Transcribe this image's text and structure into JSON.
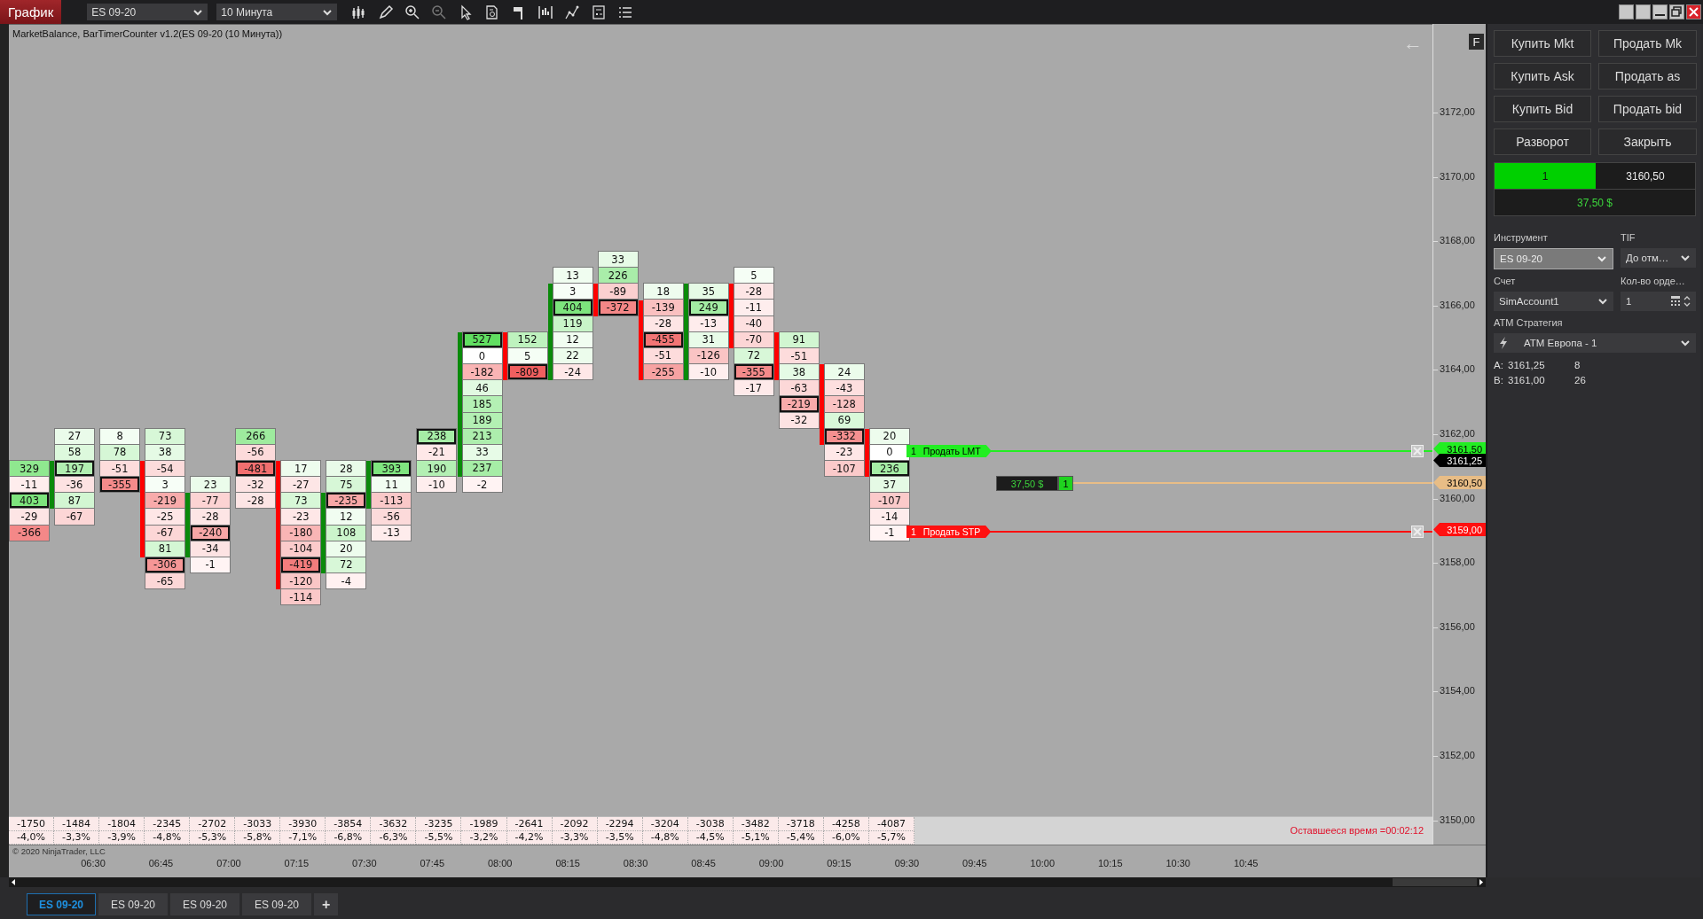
{
  "toolbar": {
    "app_button": "График",
    "instrument": "ES 09-20",
    "interval": "10 Минута"
  },
  "chart": {
    "title": "MarketBalance, BarTimerCounter v1.2(ES 09-20 (10 Минута))",
    "back_arrow": "←",
    "flag": "F",
    "bars": [
      {
        "cells": [
          {
            "value": "329",
            "highlight": false
          },
          {
            "value": "-11",
            "highlight": false
          },
          {
            "value": "403",
            "highlight": true
          },
          {
            "value": "-29",
            "highlight": false
          },
          {
            "value": "-366",
            "highlight": false
          }
        ]
      },
      {
        "color": "#0a8a0a",
        "cells": [
          {
            "value": "27",
            "highlight": false
          },
          {
            "value": "58",
            "highlight": false
          },
          {
            "value": "197",
            "highlight": true
          },
          {
            "value": "-36",
            "highlight": false
          },
          {
            "value": "87",
            "highlight": false
          },
          {
            "value": "-67",
            "highlight": false
          }
        ]
      },
      {
        "cells": [
          {
            "value": "8",
            "highlight": false
          },
          {
            "value": "78",
            "highlight": false
          },
          {
            "value": "-51",
            "highlight": false
          },
          {
            "value": "-355",
            "highlight": true
          }
        ]
      },
      {
        "color": "#ff0000",
        "cells": [
          {
            "value": "73",
            "highlight": false
          },
          {
            "value": "38",
            "highlight": false
          },
          {
            "value": "-54",
            "highlight": false
          },
          {
            "value": "3",
            "highlight": false
          },
          {
            "value": "-219",
            "highlight": false
          },
          {
            "value": "-25",
            "highlight": false
          },
          {
            "value": "-67",
            "highlight": false
          },
          {
            "value": "81",
            "highlight": false
          },
          {
            "value": "-306",
            "highlight": true
          },
          {
            "value": "-65",
            "highlight": false
          }
        ]
      },
      {
        "color": "#0a8a0a",
        "cells": [
          {
            "value": "23",
            "highlight": false
          },
          {
            "value": "-77",
            "highlight": false
          },
          {
            "value": "-28",
            "highlight": false
          },
          {
            "value": "-240",
            "highlight": true
          },
          {
            "value": "-34",
            "highlight": false
          },
          {
            "value": "-1",
            "highlight": false
          }
        ]
      },
      {
        "cells": [
          {
            "value": "266",
            "highlight": false
          },
          {
            "value": "-56",
            "highlight": false
          },
          {
            "value": "-481",
            "highlight": true
          },
          {
            "value": "-32",
            "highlight": false
          },
          {
            "value": "-28",
            "highlight": false
          }
        ]
      },
      {
        "color": "#ff0000",
        "cells": [
          {
            "value": "17",
            "highlight": false
          },
          {
            "value": "-27",
            "highlight": false
          },
          {
            "value": "73",
            "highlight": false
          },
          {
            "value": "-23",
            "highlight": false
          },
          {
            "value": "-180",
            "highlight": false
          },
          {
            "value": "-104",
            "highlight": false
          },
          {
            "value": "-419",
            "highlight": true
          },
          {
            "value": "-120",
            "highlight": false
          },
          {
            "value": "-114",
            "highlight": false
          }
        ]
      },
      {
        "color": "#0a8a0a",
        "cells": [
          {
            "value": "28",
            "highlight": false
          },
          {
            "value": "75",
            "highlight": false
          },
          {
            "value": "-235",
            "highlight": true
          },
          {
            "value": "12",
            "highlight": false
          },
          {
            "value": "108",
            "highlight": false
          },
          {
            "value": "20",
            "highlight": false
          },
          {
            "value": "72",
            "highlight": false
          },
          {
            "value": "-4",
            "highlight": false
          }
        ]
      },
      {
        "color": "#0a8a0a",
        "cells": [
          {
            "value": "393",
            "highlight": true
          },
          {
            "value": "11",
            "highlight": false
          },
          {
            "value": "-113",
            "highlight": false
          },
          {
            "value": "-56",
            "highlight": false
          },
          {
            "value": "-13",
            "highlight": false
          }
        ]
      },
      {
        "cells": [
          {
            "value": "238",
            "highlight": true
          },
          {
            "value": "-21",
            "highlight": false
          },
          {
            "value": "190",
            "highlight": false
          },
          {
            "value": "-10",
            "highlight": false
          }
        ]
      },
      {
        "color": "#0a8a0a",
        "cells": [
          {
            "value": "527",
            "highlight": true
          },
          {
            "value": "0",
            "highlight": false
          },
          {
            "value": "-182",
            "highlight": false
          },
          {
            "value": "46",
            "highlight": false
          },
          {
            "value": "185",
            "highlight": false
          },
          {
            "value": "189",
            "highlight": false
          },
          {
            "value": "213",
            "highlight": false
          },
          {
            "value": "33",
            "highlight": false
          },
          {
            "value": "237",
            "highlight": false
          },
          {
            "value": "-2",
            "highlight": false
          }
        ]
      },
      {
        "color": "#ff0000",
        "cells": [
          {
            "value": "152",
            "highlight": false
          },
          {
            "value": "5",
            "highlight": false
          },
          {
            "value": "-809",
            "highlight": true
          }
        ]
      },
      {
        "color": "#0a8a0a",
        "cells": [
          {
            "value": "13",
            "highlight": false
          },
          {
            "value": "3",
            "highlight": false
          },
          {
            "value": "404",
            "highlight": true
          },
          {
            "value": "119",
            "highlight": false
          },
          {
            "value": "12",
            "highlight": false
          },
          {
            "value": "22",
            "highlight": false
          },
          {
            "value": "-24",
            "highlight": false
          }
        ]
      },
      {
        "color": "#ff0000",
        "cells": [
          {
            "value": "33",
            "highlight": false
          },
          {
            "value": "226",
            "highlight": false
          },
          {
            "value": "-89",
            "highlight": false
          },
          {
            "value": "-372",
            "highlight": true
          }
        ]
      },
      {
        "color": "#ff0000",
        "cells": [
          {
            "value": "18",
            "highlight": false
          },
          {
            "value": "-139",
            "highlight": false
          },
          {
            "value": "-28",
            "highlight": false
          },
          {
            "value": "-455",
            "highlight": true
          },
          {
            "value": "-51",
            "highlight": false
          },
          {
            "value": "-255",
            "highlight": false
          }
        ]
      },
      {
        "color": "#0a8a0a",
        "cells": [
          {
            "value": "35",
            "highlight": false
          },
          {
            "value": "249",
            "highlight": true
          },
          {
            "value": "-13",
            "highlight": false
          },
          {
            "value": "31",
            "highlight": false
          },
          {
            "value": "-126",
            "highlight": false
          },
          {
            "value": "-10",
            "highlight": false
          }
        ]
      },
      {
        "color": "#ff0000",
        "cells": [
          {
            "value": "5",
            "highlight": false
          },
          {
            "value": "-28",
            "highlight": false
          },
          {
            "value": "-11",
            "highlight": false
          },
          {
            "value": "-40",
            "highlight": false
          },
          {
            "value": "-70",
            "highlight": false
          },
          {
            "value": "72",
            "highlight": false
          },
          {
            "value": "-355",
            "highlight": true
          },
          {
            "value": "-17",
            "highlight": false
          }
        ]
      },
      {
        "color": "#ff0000",
        "cells": [
          {
            "value": "91",
            "highlight": false
          },
          {
            "value": "-51",
            "highlight": false
          },
          {
            "value": "38",
            "highlight": false
          },
          {
            "value": "-63",
            "highlight": false
          },
          {
            "value": "-219",
            "highlight": true
          },
          {
            "value": "-32",
            "highlight": false
          }
        ]
      },
      {
        "color": "#ff0000",
        "cells": [
          {
            "value": "24",
            "highlight": false
          },
          {
            "value": "-43",
            "highlight": false
          },
          {
            "value": "-128",
            "highlight": false
          },
          {
            "value": "69",
            "highlight": false
          },
          {
            "value": "-332",
            "highlight": true
          },
          {
            "value": "-23",
            "highlight": false
          },
          {
            "value": "-107",
            "highlight": false
          }
        ]
      },
      {
        "color": "#ff0000",
        "cells": [
          {
            "value": "20",
            "highlight": false
          },
          {
            "value": "0",
            "highlight": false
          },
          {
            "value": "236",
            "highlight": true
          },
          {
            "value": "37",
            "highlight": false
          },
          {
            "value": "-107",
            "highlight": false
          },
          {
            "value": "-14",
            "highlight": false
          },
          {
            "value": "-1",
            "highlight": false
          }
        ]
      }
    ],
    "orders": [
      {
        "kind": "limit",
        "quantity": "1",
        "label": "Продать LMT",
        "price": "3161,50"
      },
      {
        "kind": "stop",
        "quantity": "1",
        "label": "Продать STP",
        "price": "3159,00"
      }
    ],
    "position": {
      "pnl": "37,50 $",
      "quantity": "1",
      "price": "3160,50"
    },
    "last_price": "3161,25",
    "price_labels": [
      "3172,00",
      "3170,00",
      "3168,00",
      "3166,00",
      "3164,00",
      "3162,00",
      "3160,00",
      "3158,00",
      "3156,00",
      "3154,00",
      "3152,00",
      "3150,00"
    ],
    "summary": [
      {
        "delta": "-1750",
        "percent": "-4,0%"
      },
      {
        "delta": "-1484",
        "percent": "-3,3%"
      },
      {
        "delta": "-1804",
        "percent": "-3,9%"
      },
      {
        "delta": "-2345",
        "percent": "-4,8%"
      },
      {
        "delta": "-2702",
        "percent": "-5,3%"
      },
      {
        "delta": "-3033",
        "percent": "-5,8%"
      },
      {
        "delta": "-3930",
        "percent": "-7,1%"
      },
      {
        "delta": "-3854",
        "percent": "-6,8%"
      },
      {
        "delta": "-3632",
        "percent": "-6,3%"
      },
      {
        "delta": "-3235",
        "percent": "-5,5%"
      },
      {
        "delta": "-1989",
        "percent": "-3,2%"
      },
      {
        "delta": "-2641",
        "percent": "-4,2%"
      },
      {
        "delta": "-2092",
        "percent": "-3,3%"
      },
      {
        "delta": "-2294",
        "percent": "-3,5%"
      },
      {
        "delta": "-3204",
        "percent": "-4,8%"
      },
      {
        "delta": "-3038",
        "percent": "-4,5%"
      },
      {
        "delta": "-3482",
        "percent": "-5,1%"
      },
      {
        "delta": "-3718",
        "percent": "-5,4%"
      },
      {
        "delta": "-4258",
        "percent": "-6,0%"
      },
      {
        "delta": "-4087",
        "percent": "-5,7%"
      }
    ],
    "copyright": "© 2020 NinjaTrader, LLC",
    "timer": "Оставшееся время =00:02:12",
    "time_labels": [
      "06:30",
      "06:45",
      "07:00",
      "07:15",
      "07:30",
      "07:45",
      "08:00",
      "08:15",
      "08:30",
      "08:45",
      "09:00",
      "09:15",
      "09:30",
      "09:45",
      "10:00",
      "10:15",
      "10:30",
      "10:45"
    ]
  },
  "panel": {
    "buttons": [
      "Купить Mkt",
      "Продать Mk",
      "Купить Ask",
      "Продать as",
      "Купить Bid",
      "Продать bid",
      "Разворот",
      "Закрыть"
    ],
    "position": {
      "quantity": "1",
      "price": "3160,50",
      "pnl": "37,50 $"
    },
    "instrument": {
      "label": "Инструмент",
      "value": "ES 09-20",
      "disabled": true
    },
    "tif": {
      "label": "TIF",
      "value": "До отм…"
    },
    "account": {
      "label": "Счет",
      "value": "SimAccount1"
    },
    "order_qty": {
      "label": "Кол-во орде…",
      "value": "1"
    },
    "atm": {
      "label": "ATM Стратегия",
      "value": "ATM Европа - 1"
    },
    "ask": {
      "label": "A:",
      "price": "3161,25",
      "size": "8"
    },
    "bid": {
      "label": "B:",
      "price": "3161,00",
      "size": "26"
    }
  },
  "tabs": [
    {
      "label": "ES 09-20",
      "selected": true
    },
    {
      "label": "ES 09-20",
      "selected": false
    },
    {
      "label": "ES 09-20",
      "selected": false
    },
    {
      "label": "ES 09-20",
      "selected": false
    }
  ],
  "add_tab": "+"
}
